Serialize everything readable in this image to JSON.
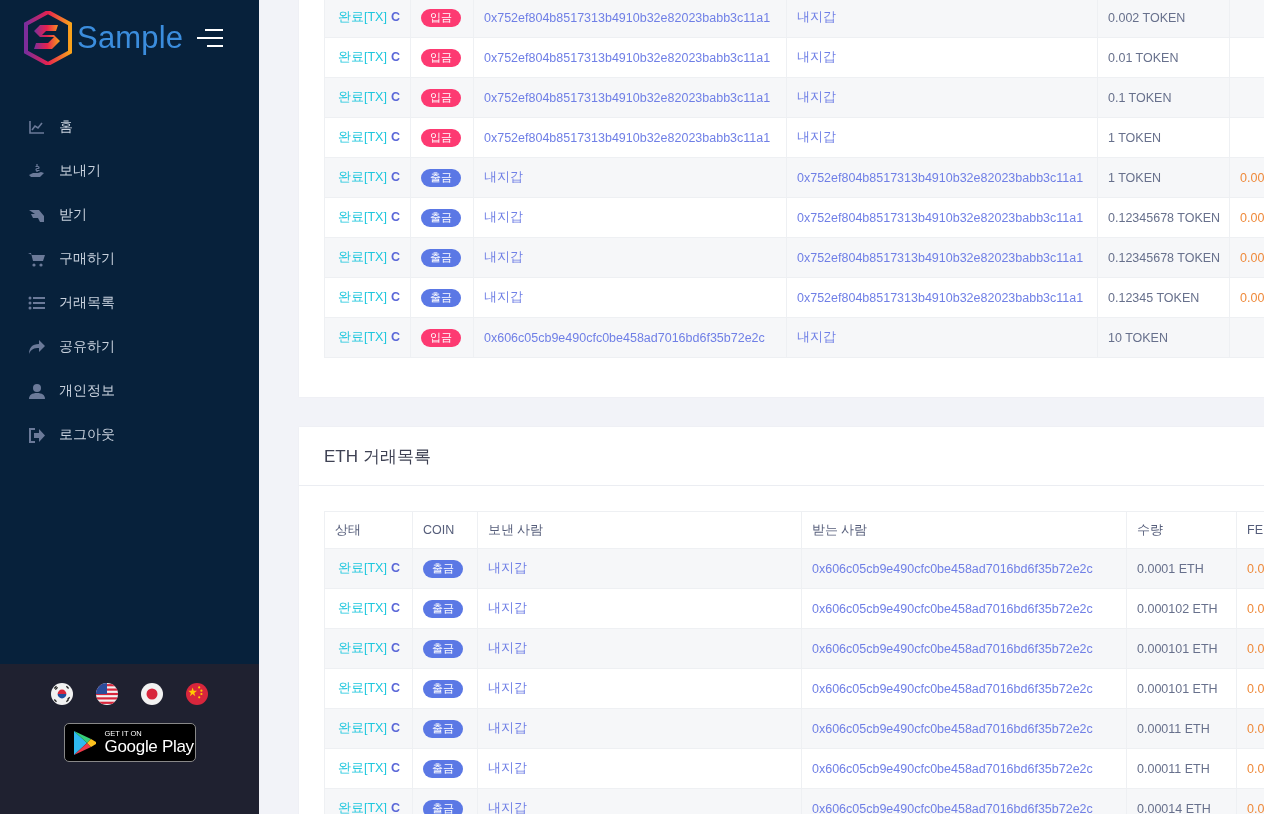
{
  "sidebar": {
    "brand": "Sample",
    "menu": [
      {
        "label": "홈"
      },
      {
        "label": "보내기"
      },
      {
        "label": "받기"
      },
      {
        "label": "구매하기"
      },
      {
        "label": "거래목록"
      },
      {
        "label": "공유하기"
      },
      {
        "label": "개인정보"
      },
      {
        "label": "로그아웃"
      }
    ],
    "store_badge": {
      "small": "GET IT ON",
      "large": "Google Play"
    }
  },
  "token_table": {
    "rows": [
      {
        "status": "완료[TX]",
        "link": "C",
        "kind": "deposit",
        "coin": "입금",
        "from": "0x752ef804b8517313b4910b32e82023babb3c11a1",
        "to": "내지갑",
        "amount": "0.002 TOKEN"
      },
      {
        "status": "완료[TX]",
        "link": "C",
        "kind": "deposit",
        "coin": "입금",
        "from": "0x752ef804b8517313b4910b32e82023babb3c11a1",
        "to": "내지갑",
        "amount": "0.01 TOKEN"
      },
      {
        "status": "완료[TX]",
        "link": "C",
        "kind": "deposit",
        "coin": "입금",
        "from": "0x752ef804b8517313b4910b32e82023babb3c11a1",
        "to": "내지갑",
        "amount": "0.1 TOKEN"
      },
      {
        "status": "완료[TX]",
        "link": "C",
        "kind": "deposit",
        "coin": "입금",
        "from": "0x752ef804b8517313b4910b32e82023babb3c11a1",
        "to": "내지갑",
        "amount": "1 TOKEN"
      },
      {
        "status": "완료[TX]",
        "link": "C",
        "kind": "withdraw",
        "coin": "출금",
        "from": "내지갑",
        "to": "0x752ef804b8517313b4910b32e82023babb3c11a1",
        "amount": "1 TOKEN",
        "fee": "0.00"
      },
      {
        "status": "완료[TX]",
        "link": "C",
        "kind": "withdraw",
        "coin": "출금",
        "from": "내지갑",
        "to": "0x752ef804b8517313b4910b32e82023babb3c11a1",
        "amount": "0.12345678 TOKEN",
        "fee": "0.00"
      },
      {
        "status": "완료[TX]",
        "link": "C",
        "kind": "withdraw",
        "coin": "출금",
        "from": "내지갑",
        "to": "0x752ef804b8517313b4910b32e82023babb3c11a1",
        "amount": "0.12345678 TOKEN",
        "fee": "0.00"
      },
      {
        "status": "완료[TX]",
        "link": "C",
        "kind": "withdraw",
        "coin": "출금",
        "from": "내지갑",
        "to": "0x752ef804b8517313b4910b32e82023babb3c11a1",
        "amount": "0.12345 TOKEN",
        "fee": "0.00"
      },
      {
        "status": "완료[TX]",
        "link": "C",
        "kind": "deposit",
        "coin": "입금",
        "from": "0x606c05cb9e490cfc0be458ad7016bd6f35b72e2c",
        "to": "내지갑",
        "amount": "10 TOKEN"
      }
    ]
  },
  "eth_table": {
    "title": "ETH 거래목록",
    "columns": [
      "상태",
      "COIN",
      "보낸 사람",
      "받는 사람",
      "수량",
      "FE"
    ],
    "rows": [
      {
        "status": "완료[TX]",
        "link": "C",
        "kind": "withdraw",
        "coin": "출금",
        "from": "내지갑",
        "to": "0x606c05cb9e490cfc0be458ad7016bd6f35b72e2c",
        "amount": "0.0001 ETH",
        "fee": "0.0"
      },
      {
        "status": "완료[TX]",
        "link": "C",
        "kind": "withdraw",
        "coin": "출금",
        "from": "내지갑",
        "to": "0x606c05cb9e490cfc0be458ad7016bd6f35b72e2c",
        "amount": "0.000102 ETH",
        "fee": "0.0"
      },
      {
        "status": "완료[TX]",
        "link": "C",
        "kind": "withdraw",
        "coin": "출금",
        "from": "내지갑",
        "to": "0x606c05cb9e490cfc0be458ad7016bd6f35b72e2c",
        "amount": "0.000101 ETH",
        "fee": "0.0"
      },
      {
        "status": "완료[TX]",
        "link": "C",
        "kind": "withdraw",
        "coin": "출금",
        "from": "내지갑",
        "to": "0x606c05cb9e490cfc0be458ad7016bd6f35b72e2c",
        "amount": "0.000101 ETH",
        "fee": "0.0"
      },
      {
        "status": "완료[TX]",
        "link": "C",
        "kind": "withdraw",
        "coin": "출금",
        "from": "내지갑",
        "to": "0x606c05cb9e490cfc0be458ad7016bd6f35b72e2c",
        "amount": "0.00011 ETH",
        "fee": "0.0"
      },
      {
        "status": "완료[TX]",
        "link": "C",
        "kind": "withdraw",
        "coin": "출금",
        "from": "내지갑",
        "to": "0x606c05cb9e490cfc0be458ad7016bd6f35b72e2c",
        "amount": "0.00011 ETH",
        "fee": "0.0"
      },
      {
        "status": "완료[TX]",
        "link": "C",
        "kind": "withdraw",
        "coin": "출금",
        "from": "내지갑",
        "to": "0x606c05cb9e490cfc0be458ad7016bd6f35b72e2c",
        "amount": "0.00014 ETH",
        "fee": "0.0"
      }
    ]
  }
}
